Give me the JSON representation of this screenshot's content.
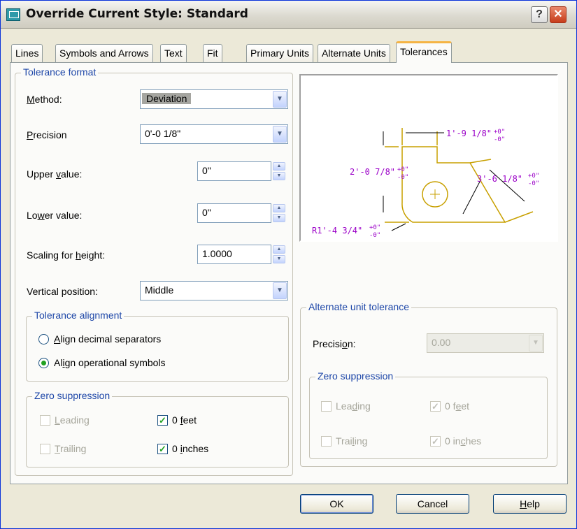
{
  "window": {
    "title": "Override Current Style: Standard",
    "help": "?",
    "close": "✕"
  },
  "tabs": [
    "Lines",
    "Symbols and Arrows",
    "Text",
    "Fit",
    "Primary Units",
    "Alternate Units",
    "Tolerances"
  ],
  "active_tab": "Tolerances",
  "tolerance_format": {
    "title": "Tolerance format",
    "method": {
      "label_pre": "",
      "label_ul": "M",
      "label_post": "ethod:",
      "value": "Deviation"
    },
    "precision": {
      "label_pre": "",
      "label_ul": "P",
      "label_post": "recision",
      "value": "0'-0 1/8\""
    },
    "upper": {
      "label_pre": "Upper ",
      "label_ul": "v",
      "label_post": "alue:",
      "value": "0\""
    },
    "lower": {
      "label_pre": "Lo",
      "label_ul": "w",
      "label_post": "er value:",
      "value": "0\""
    },
    "scaling": {
      "label_pre": "Scaling for ",
      "label_ul": "h",
      "label_post": "eight:",
      "value": "1.0000"
    },
    "vertical": {
      "label_pre": "Vertical position:",
      "label_ul": "",
      "label_post": "",
      "value": "Middle"
    }
  },
  "tolerance_alignment": {
    "title": "Tolerance alignment",
    "opt1": {
      "pre": "",
      "ul": "A",
      "post": "lign decimal separators",
      "checked": false
    },
    "opt2": {
      "pre": "Al",
      "ul": "i",
      "post": "gn operational symbols",
      "checked": true
    }
  },
  "zero_suppression": {
    "title": "Zero suppression",
    "leading": {
      "pre": "",
      "ul": "L",
      "post": "eading",
      "checked": false,
      "enabled": false
    },
    "trailing": {
      "pre": "",
      "ul": "T",
      "post": "railing",
      "checked": false,
      "enabled": false
    },
    "feet": {
      "pre": "0 ",
      "ul": "f",
      "post": "eet",
      "checked": true,
      "enabled": true
    },
    "inches": {
      "pre": "0 ",
      "ul": "i",
      "post": "nches",
      "checked": true,
      "enabled": true
    }
  },
  "preview": {
    "dim1": "1'-9 1/8\"",
    "dim2": "2'-0 7/8\"",
    "dim3": "3'-6 1/8\"",
    "dim4": "R1'-4 3/4\"",
    "tol_plus": "+0\"",
    "tol_minus": "-0\"",
    "color_geometry": "#c8a000",
    "color_text": "#9b00c8"
  },
  "alternate_tolerance": {
    "title": "Alternate unit tolerance",
    "precision": {
      "pre": "Precisi",
      "ul": "o",
      "post": "n:",
      "value": "0.00"
    },
    "zero_title": "Zero suppression",
    "leading": {
      "pre": "Lea",
      "ul": "d",
      "post": "ing",
      "checked": false
    },
    "trailing": {
      "pre": "Trai",
      "ul": "l",
      "post": "ing",
      "checked": false
    },
    "feet": {
      "pre": "0 f",
      "ul": "e",
      "post": "et",
      "checked": true
    },
    "inches": {
      "pre": "0 in",
      "ul": "c",
      "post": "hes",
      "checked": true
    }
  },
  "buttons": {
    "ok": "OK",
    "cancel": "Cancel",
    "help_pre": "",
    "help_ul": "H",
    "help_post": "elp"
  }
}
